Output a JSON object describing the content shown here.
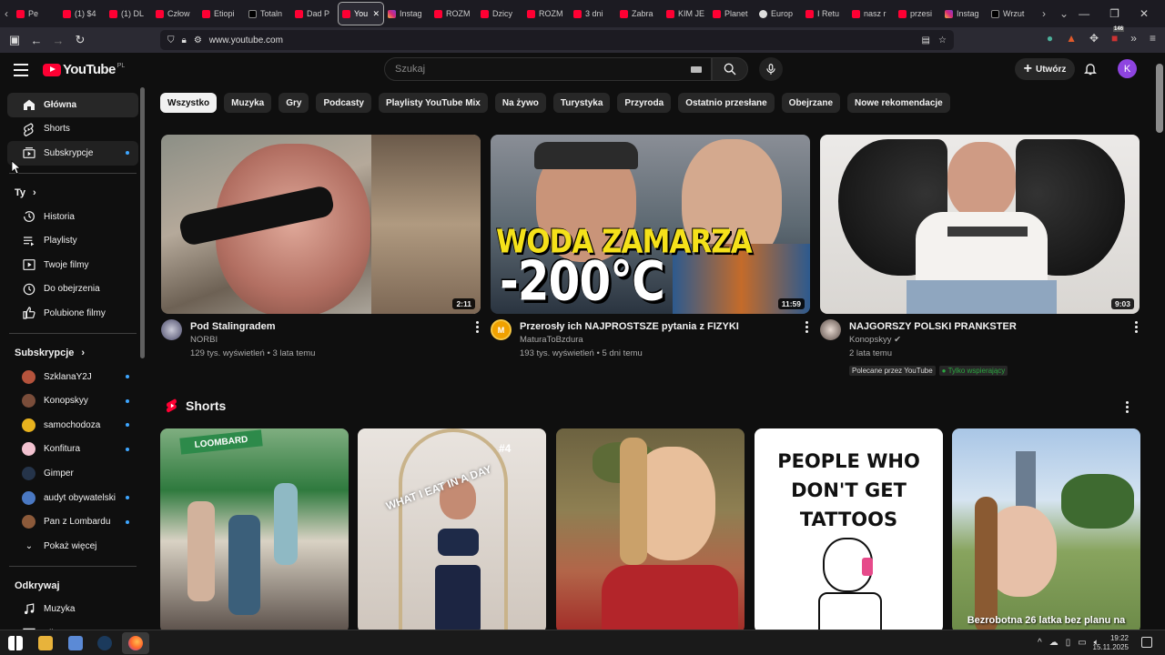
{
  "browser": {
    "tabs": [
      {
        "label": "Pe",
        "fav": "yt"
      },
      {
        "label": "(1) $4",
        "fav": "yt"
      },
      {
        "label": "(1) DL",
        "fav": "yt"
      },
      {
        "label": "Człow",
        "fav": "yt"
      },
      {
        "label": "Etiopi",
        "fav": "yt"
      },
      {
        "label": "Totaln",
        "fav": "x"
      },
      {
        "label": "Dad P",
        "fav": "yt"
      },
      {
        "label": "You",
        "fav": "yt",
        "active": true
      },
      {
        "label": "Instag",
        "fav": "ig"
      },
      {
        "label": "ROZM",
        "fav": "yt"
      },
      {
        "label": "Dzicy",
        "fav": "yt"
      },
      {
        "label": "ROZM",
        "fav": "yt"
      },
      {
        "label": "3 dni",
        "fav": "yt"
      },
      {
        "label": "Zabra",
        "fav": "yt"
      },
      {
        "label": "KIM JE",
        "fav": "yt"
      },
      {
        "label": "Planet",
        "fav": "yt"
      },
      {
        "label": "Europ",
        "fav": "globe"
      },
      {
        "label": "I Retu",
        "fav": "yt"
      },
      {
        "label": "nasz r",
        "fav": "yt"
      },
      {
        "label": "przesi",
        "fav": "yt"
      },
      {
        "label": "Instag",
        "fav": "ig"
      },
      {
        "label": "Wrzut",
        "fav": "x"
      }
    ],
    "url": "www.youtube.com",
    "badge_count": "146"
  },
  "header": {
    "logo_text": "YouTube",
    "region": "PL",
    "search_placeholder": "Szukaj",
    "create_label": "Utwórz",
    "avatar_letter": "K"
  },
  "sidebar": {
    "main": [
      {
        "label": "Główna",
        "icon": "home-icon",
        "active": true
      },
      {
        "label": "Shorts",
        "icon": "shorts-icon"
      },
      {
        "label": "Subskrypcje",
        "icon": "subscriptions-icon",
        "dot": true
      }
    ],
    "you_title": "Ty",
    "you": [
      {
        "label": "Historia",
        "icon": "history-icon"
      },
      {
        "label": "Playlisty",
        "icon": "playlists-icon"
      },
      {
        "label": "Twoje filmy",
        "icon": "your-videos-icon"
      },
      {
        "label": "Do obejrzenia",
        "icon": "watch-later-icon"
      },
      {
        "label": "Polubione filmy",
        "icon": "liked-icon"
      }
    ],
    "subs_title": "Subskrypcje",
    "subs": [
      {
        "label": "SzklanaY2J",
        "color": "#b5533c",
        "dot": true
      },
      {
        "label": "Konopskyy",
        "color": "#7a4d3a",
        "dot": true
      },
      {
        "label": "samochodoza",
        "color": "#e8b21e",
        "dot": true
      },
      {
        "label": "Konfitura",
        "color": "#f2c2d0",
        "dot": true
      },
      {
        "label": "Gimper",
        "color": "#25344a",
        "dot": false
      },
      {
        "label": "audyt obywatelski",
        "color": "#4a78c2",
        "dot": true
      },
      {
        "label": "Pan z Lombardu",
        "color": "#8c5a3a",
        "dot": true
      }
    ],
    "show_more": "Pokaż więcej",
    "explore_title": "Odkrywaj",
    "explore": [
      {
        "label": "Muzyka",
        "icon": "music-icon"
      },
      {
        "label": "Filmy",
        "icon": "movies-icon"
      }
    ]
  },
  "chips": [
    "Wszystko",
    "Muzyka",
    "Gry",
    "Podcasty",
    "Playlisty YouTube Mix",
    "Na żywo",
    "Turystyka",
    "Przyroda",
    "Ostatnio przesłane",
    "Obejrzane",
    "Nowe rekomendacje"
  ],
  "videos": [
    {
      "title": "Pod Stalingradem",
      "channel": "NORBI",
      "stats": "129 tys. wyświetleń • 3 lata temu",
      "duration": "2:11"
    },
    {
      "title": "Przerosły ich NAJPROSTSZE pytania z FIZYKI",
      "channel": "MaturaToBzdura",
      "stats": "193 tys. wyświetleń • 5 dni temu",
      "duration": "11:59",
      "thumb_line1": "WODA ZAMARZA",
      "thumb_line2": "-200°C"
    },
    {
      "title": "NAJGORSZY POLSKI PRANKSTER",
      "channel": "Konopskyy",
      "stats": "2 lata temu",
      "duration": "9:03",
      "badge1": "Polecane przez YouTube",
      "badge2": "Tylko wspierający"
    }
  ],
  "shorts": {
    "title": "Shorts",
    "items": [
      {
        "overlay": ""
      },
      {
        "overlay": "WHAT I EAT IN A DAY",
        "tag": "#4"
      },
      {
        "overlay": ""
      },
      {
        "overlay": "PEOPLE WHO DON'T GET TATTOOS"
      },
      {
        "overlay": "Bezrobotna 26 latka bez planu na"
      }
    ]
  },
  "taskbar": {
    "time": "19:22",
    "date": "15.11.2025"
  }
}
